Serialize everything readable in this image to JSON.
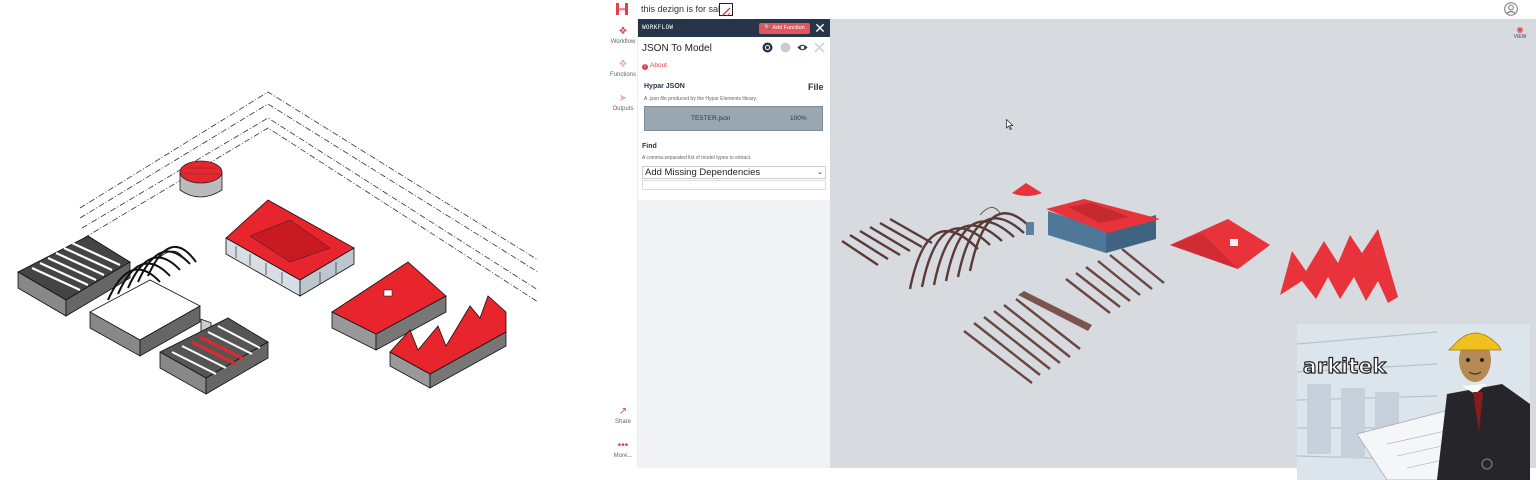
{
  "topbar": {
    "title": "this dezign is for sale"
  },
  "rail": {
    "items": [
      {
        "label": "Workflow",
        "icon": "workflow-icon"
      },
      {
        "label": "Functions",
        "icon": "functions-icon"
      },
      {
        "label": "Outputs",
        "icon": "outputs-icon"
      },
      {
        "label": "Share",
        "icon": "share-icon"
      },
      {
        "label": "More...",
        "icon": "more-icon"
      }
    ]
  },
  "panel": {
    "header": "WORKFLOW",
    "add_function": "Add Function",
    "function_name": "JSON To Model",
    "about": "About",
    "input_label": "Hypar JSON",
    "input_type": "File",
    "input_desc": "A .json file produced by the Hypar Elements library.",
    "file_name": "TESTER.json",
    "file_progress": "100%",
    "find_label": "Find",
    "find_desc": "A comma-separated list of model types to extract.",
    "select_value": "Add Missing Dependencies"
  },
  "viewport": {
    "view_label": "VIEW"
  },
  "meme": {
    "caption": "arkitek"
  },
  "colors": {
    "brand": "#e0414c",
    "header_bg": "#263549",
    "viewport_bg": "#d7dadf",
    "roof_red": "#e8333b"
  }
}
